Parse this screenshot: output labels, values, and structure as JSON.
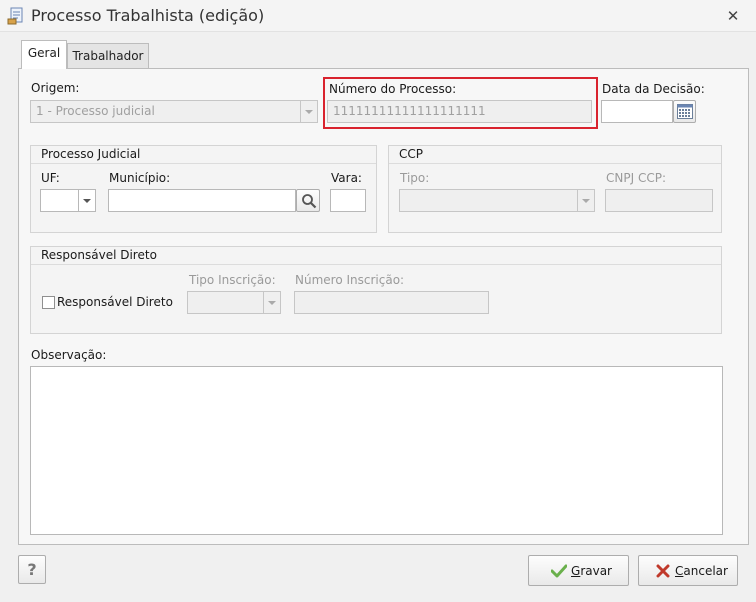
{
  "window": {
    "title": "Processo Trabalhista (edição)",
    "close_glyph": "✕"
  },
  "tabs": [
    {
      "label": "Geral"
    },
    {
      "label": "Trabalhador"
    }
  ],
  "form": {
    "origem": {
      "label": "Origem:",
      "value": "1 - Processo judicial"
    },
    "numero_processo": {
      "label": "Número do Processo:",
      "value": "11111111111111111111"
    },
    "data_decisao": {
      "label": "Data da Decisão:",
      "value": ""
    },
    "processo_judicial": {
      "title": "Processo Judicial",
      "uf_label": "UF:",
      "uf_value": "",
      "municipio_label": "Município:",
      "municipio_value": "",
      "vara_label": "Vara:",
      "vara_value": ""
    },
    "ccp": {
      "title": "CCP",
      "tipo_label": "Tipo:",
      "tipo_value": "",
      "cnpj_label": "CNPJ CCP:",
      "cnpj_value": ""
    },
    "responsavel_direto": {
      "title": "Responsável Direto",
      "checkbox_label": "Responsável Direto",
      "checked": false,
      "tipo_inscricao_label": "Tipo Inscrição:",
      "tipo_inscricao_value": "",
      "numero_inscricao_label": "Número Inscrição:",
      "numero_inscricao_value": ""
    },
    "observacao": {
      "label": "Observação:",
      "value": ""
    }
  },
  "buttons": {
    "help": "?",
    "gravar": {
      "first": "G",
      "rest": "ravar"
    },
    "cancelar": {
      "first": "C",
      "rest": "ancelar"
    }
  },
  "colors": {
    "highlight": "#d9232e",
    "check": "#6ab04c",
    "cancel": "#c0392b"
  }
}
